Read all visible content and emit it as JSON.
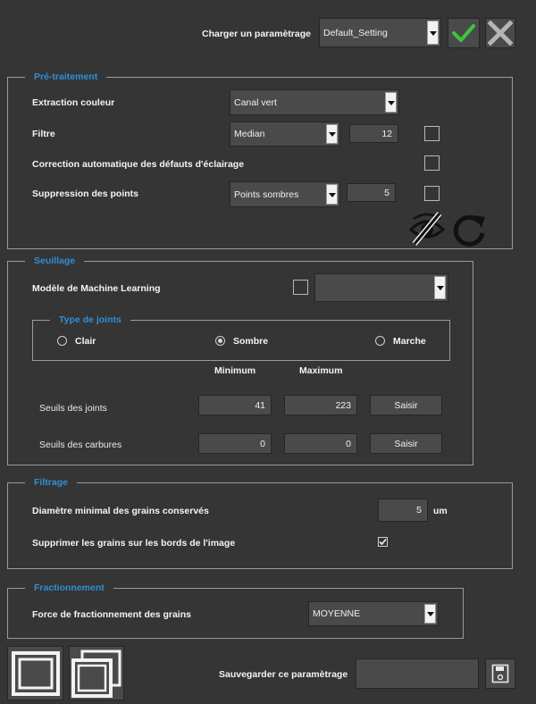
{
  "header": {
    "load_label": "Charger un paramètrage",
    "setting_value": "Default_Setting",
    "confirm_icon": "check-icon",
    "cancel_icon": "close-icon",
    "accent": "#2e8fd6",
    "confirm_color": "#3cc63c"
  },
  "pretraitement": {
    "title": "Pré-traitement",
    "color_extraction_label": "Extraction couleur",
    "color_extraction_value": "Canal vert",
    "filter_label": "Filtre",
    "filter_value": "Median",
    "filter_size": "12",
    "lighting_label": "Correction automatique des défauts d'éclairage",
    "points_label": "Suppression des points",
    "points_value": "Points sombres",
    "points_size": "5",
    "preview_icon": "eye-off-icon",
    "refresh_icon": "refresh-icon"
  },
  "seuillage": {
    "title": "Seuillage",
    "ml_label": "Modèle de Machine Learning",
    "ml_value": "",
    "joint_type_title": "Type de joints",
    "options": [
      "Clair",
      "Sombre",
      "Marche"
    ],
    "selected": "Sombre",
    "min_header": "Minimum",
    "max_header": "Maximum",
    "rows": [
      {
        "label": "Seuils des joints",
        "min": "41",
        "max": "223",
        "button": "Saisir"
      },
      {
        "label": "Seuils des carbures",
        "min": "0",
        "max": "0",
        "button": "Saisir"
      }
    ]
  },
  "filtrage": {
    "title": "Filtrage",
    "min_diameter_label": "Diamètre minimal des grains conservés",
    "min_diameter_value": "5",
    "unit": "um",
    "remove_edges_label": "Supprimer les grains sur les bords de l'image",
    "remove_edges_checked": true
  },
  "fractionnement": {
    "title": "Fractionnement",
    "strength_label": "Force de fractionnement des grains",
    "strength_value": "MOYENNE"
  },
  "footer": {
    "single_view_icon": "single-window-icon",
    "multi_view_icon": "multi-window-icon",
    "save_label": "Sauvegarder ce paramètrage",
    "save_name_value": "",
    "save_icon": "save-disk-icon"
  }
}
